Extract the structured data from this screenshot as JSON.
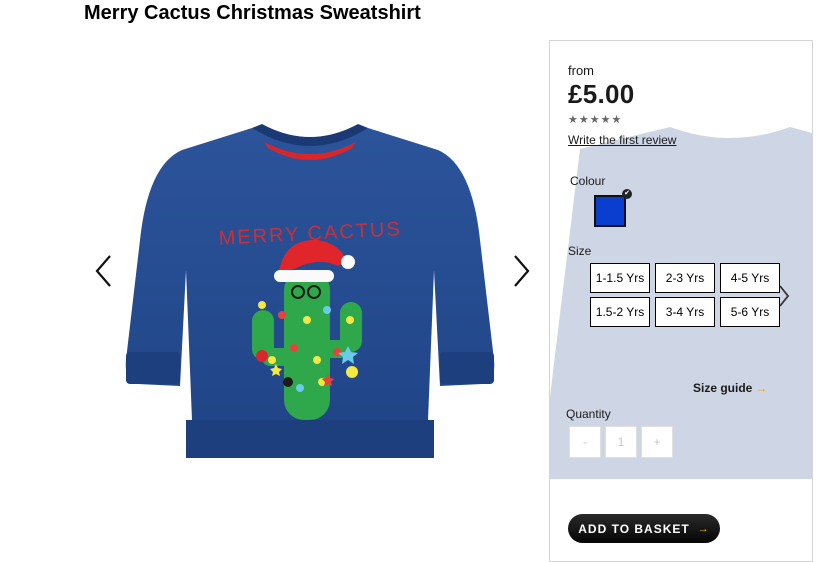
{
  "product": {
    "title": "Merry Cactus Christmas Sweatshirt",
    "image_text": "MERRY CACTUS"
  },
  "gallery": {
    "prev_icon": "chevron-left-icon",
    "next_icon": "chevron-right-icon"
  },
  "panel": {
    "from_label": "from",
    "price": "£5.00",
    "rating_stars": 5,
    "review_link": "Write the first review",
    "colour_label": "Colour",
    "selected_colour": "#0a3ecf",
    "size_label": "Size",
    "sizes": [
      "1-1.5 Yrs",
      "2-3 Yrs",
      "4-5 Yrs",
      "1.5-2 Yrs",
      "3-4 Yrs",
      "5-6 Yrs"
    ],
    "size_guide": "Size guide",
    "quantity_label": "Quantity",
    "qty_minus": "-",
    "qty_value": "1",
    "qty_plus": "+",
    "basket_label": "ADD TO BASKET"
  },
  "colors": {
    "sweatshirt": "#254a8f",
    "accent_arrow": "#f0a400",
    "cactus": "#2ea84a"
  }
}
